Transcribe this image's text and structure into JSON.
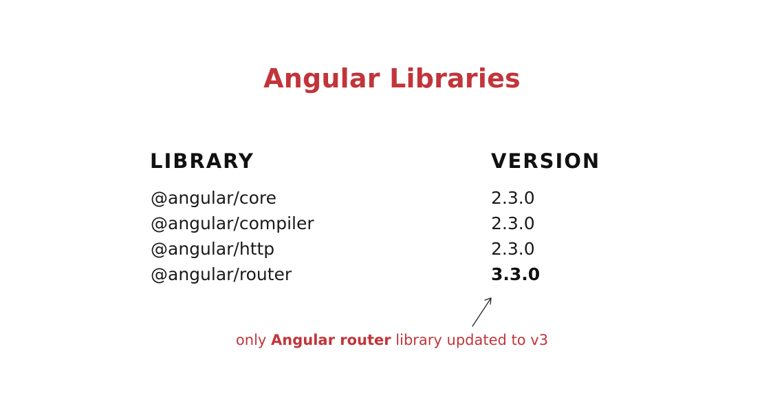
{
  "title": "Angular Libraries",
  "table": {
    "headers": {
      "library": "LIBRARY",
      "version": "VERSION"
    },
    "rows": [
      {
        "library": "@angular/core",
        "version": "2.3.0"
      },
      {
        "library": "@angular/compiler",
        "version": "2.3.0"
      },
      {
        "library": "@angular/http",
        "version": "2.3.0"
      },
      {
        "library": "@angular/router",
        "version": "3.3.0",
        "highlighted": true
      }
    ]
  },
  "annotation": {
    "prefix": "only ",
    "emphasis": "Angular router",
    "suffix": " library updated to v3",
    "pointer_icon": "arrow-up-right-icon"
  },
  "colors": {
    "accent": "#c1353a",
    "text": "#1a1a1a",
    "background": "#ffffff"
  }
}
